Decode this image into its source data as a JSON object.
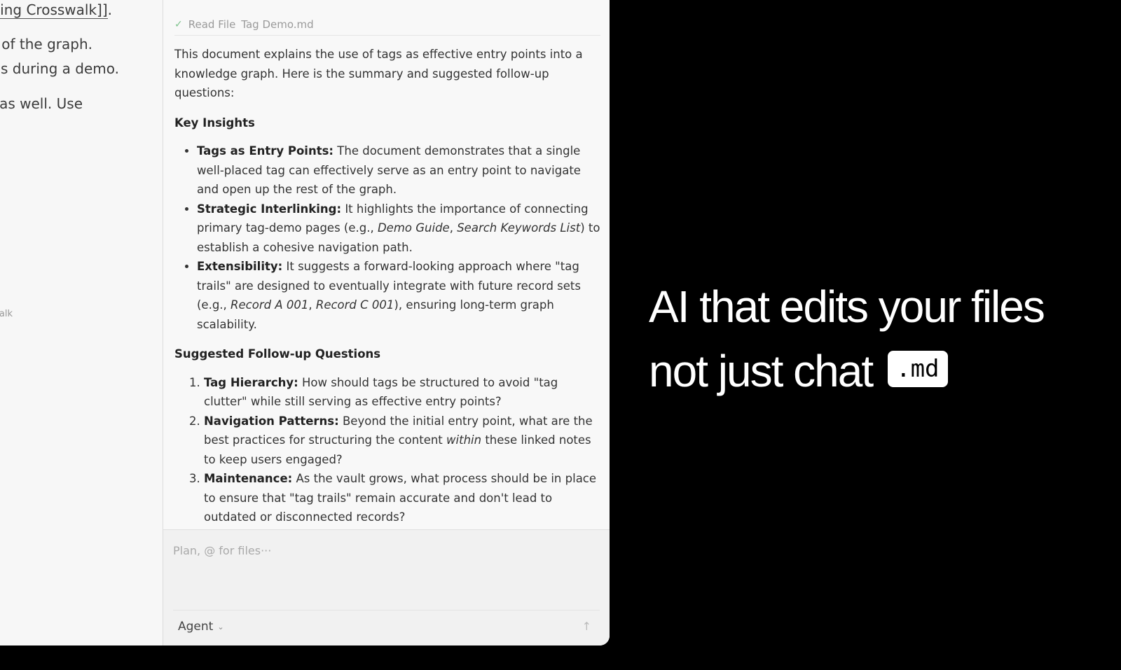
{
  "editor": {
    "line1_prefix": "ing Crosswalk]]",
    "line1_suffix": ".",
    "line2": "t of the graph.",
    "line3": "es during a demo.",
    "line4": "as well. Use",
    "line5": "alk"
  },
  "chat": {
    "tool_status": "✓",
    "tool_action": "Read File",
    "tool_file": "Tag Demo.md",
    "intro": "This document explains the use of tags as effective entry points into a knowledge graph. Here is the summary and suggested follow-up questions:",
    "insights_heading": "Key Insights",
    "insights": [
      {
        "title": "Tags as Entry Points:",
        "text": "The document demonstrates that a single well-placed tag can effectively serve as an entry point to navigate and open up the rest of the graph."
      },
      {
        "title": "Strategic Interlinking:",
        "text_a": "It highlights the importance of connecting primary tag-demo pages (e.g., ",
        "em1": "Demo Guide",
        "sep": ", ",
        "em2": "Search Keywords List",
        "text_b": ") to establish a cohesive navigation path."
      },
      {
        "title": "Extensibility:",
        "text_a": "It suggests a forward-looking approach where \"tag trails\" are designed to eventually integrate with future record sets (e.g., ",
        "em1": "Record A 001",
        "sep": ", ",
        "em2": "Record C 001",
        "text_b": "), ensuring long-term graph scalability."
      }
    ],
    "questions_heading": "Suggested Follow-up Questions",
    "questions": [
      {
        "title": "Tag Hierarchy:",
        "text": "How should tags be structured to avoid \"tag clutter\" while still serving as effective entry points?"
      },
      {
        "title": "Navigation Patterns:",
        "text_a": "Beyond the initial entry point, what are the best practices for structuring the content ",
        "em": "within",
        "text_b": " these linked notes to keep users engaged?"
      },
      {
        "title": "Maintenance:",
        "text": "As the vault grows, what process should be in place to ensure that \"tag trails\" remain accurate and don't lead to outdated or disconnected records?"
      }
    ]
  },
  "input": {
    "placeholder": "Plan, @ for files···",
    "mode": "Agent",
    "chevron": "⌄",
    "send": "↑"
  },
  "headline": {
    "line1": "AI that edits your files",
    "line2": "not just chat",
    "badge": ".md"
  }
}
